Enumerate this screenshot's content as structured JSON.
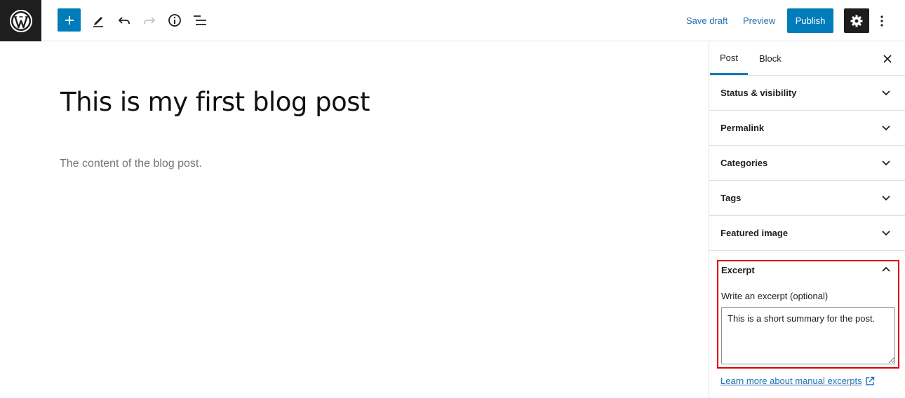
{
  "toolbar": {
    "save_draft": "Save draft",
    "preview": "Preview",
    "publish": "Publish"
  },
  "editor": {
    "title": "This is my first blog post",
    "content": "The content of the blog post."
  },
  "sidebar": {
    "tabs": [
      {
        "label": "Post",
        "active": true
      },
      {
        "label": "Block",
        "active": false
      }
    ],
    "panels": [
      {
        "label": "Status & visibility"
      },
      {
        "label": "Permalink"
      },
      {
        "label": "Categories"
      },
      {
        "label": "Tags"
      },
      {
        "label": "Featured image"
      }
    ],
    "excerpt": {
      "label": "Excerpt",
      "help": "Write an excerpt (optional)",
      "value": "This is a short summary for the post.",
      "learn_more": "Learn more about manual excerpts"
    }
  },
  "colors": {
    "accent": "#007cba",
    "dark": "#1e1e1e",
    "highlight": "#e00000",
    "link": "#2271b1"
  }
}
